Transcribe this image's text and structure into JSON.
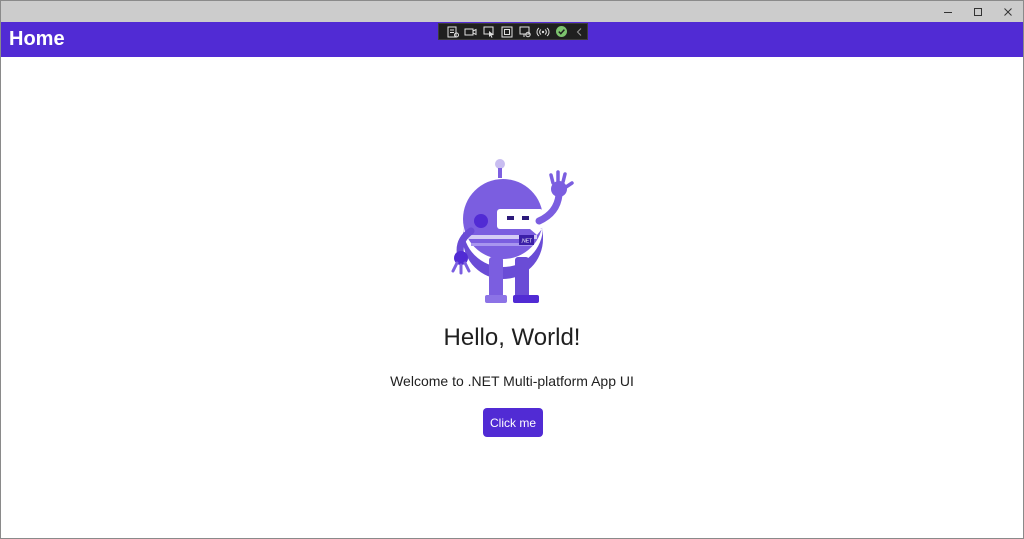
{
  "window": {
    "controls": {
      "minimize_icon": "minimize-icon",
      "maximize_icon": "maximize-icon",
      "close_icon": "close-icon"
    }
  },
  "header": {
    "title": "Home",
    "background": "#512bd4"
  },
  "debug_toolbar": {
    "icons": [
      "live-visual-tree-icon",
      "camera-icon",
      "select-element-icon",
      "display-layout-adorners-icon",
      "track-focus-icon",
      "hot-reload-icon",
      "hot-reload-status-check-icon",
      "collapse-chevron-icon"
    ]
  },
  "main": {
    "illustration": "dotnet-bot-waving",
    "bot_badge": ".NET",
    "headline": "Hello, World!",
    "subheadline": "Welcome to .NET Multi-platform App UI",
    "button_label": "Click me",
    "accent": "#512bd4"
  }
}
